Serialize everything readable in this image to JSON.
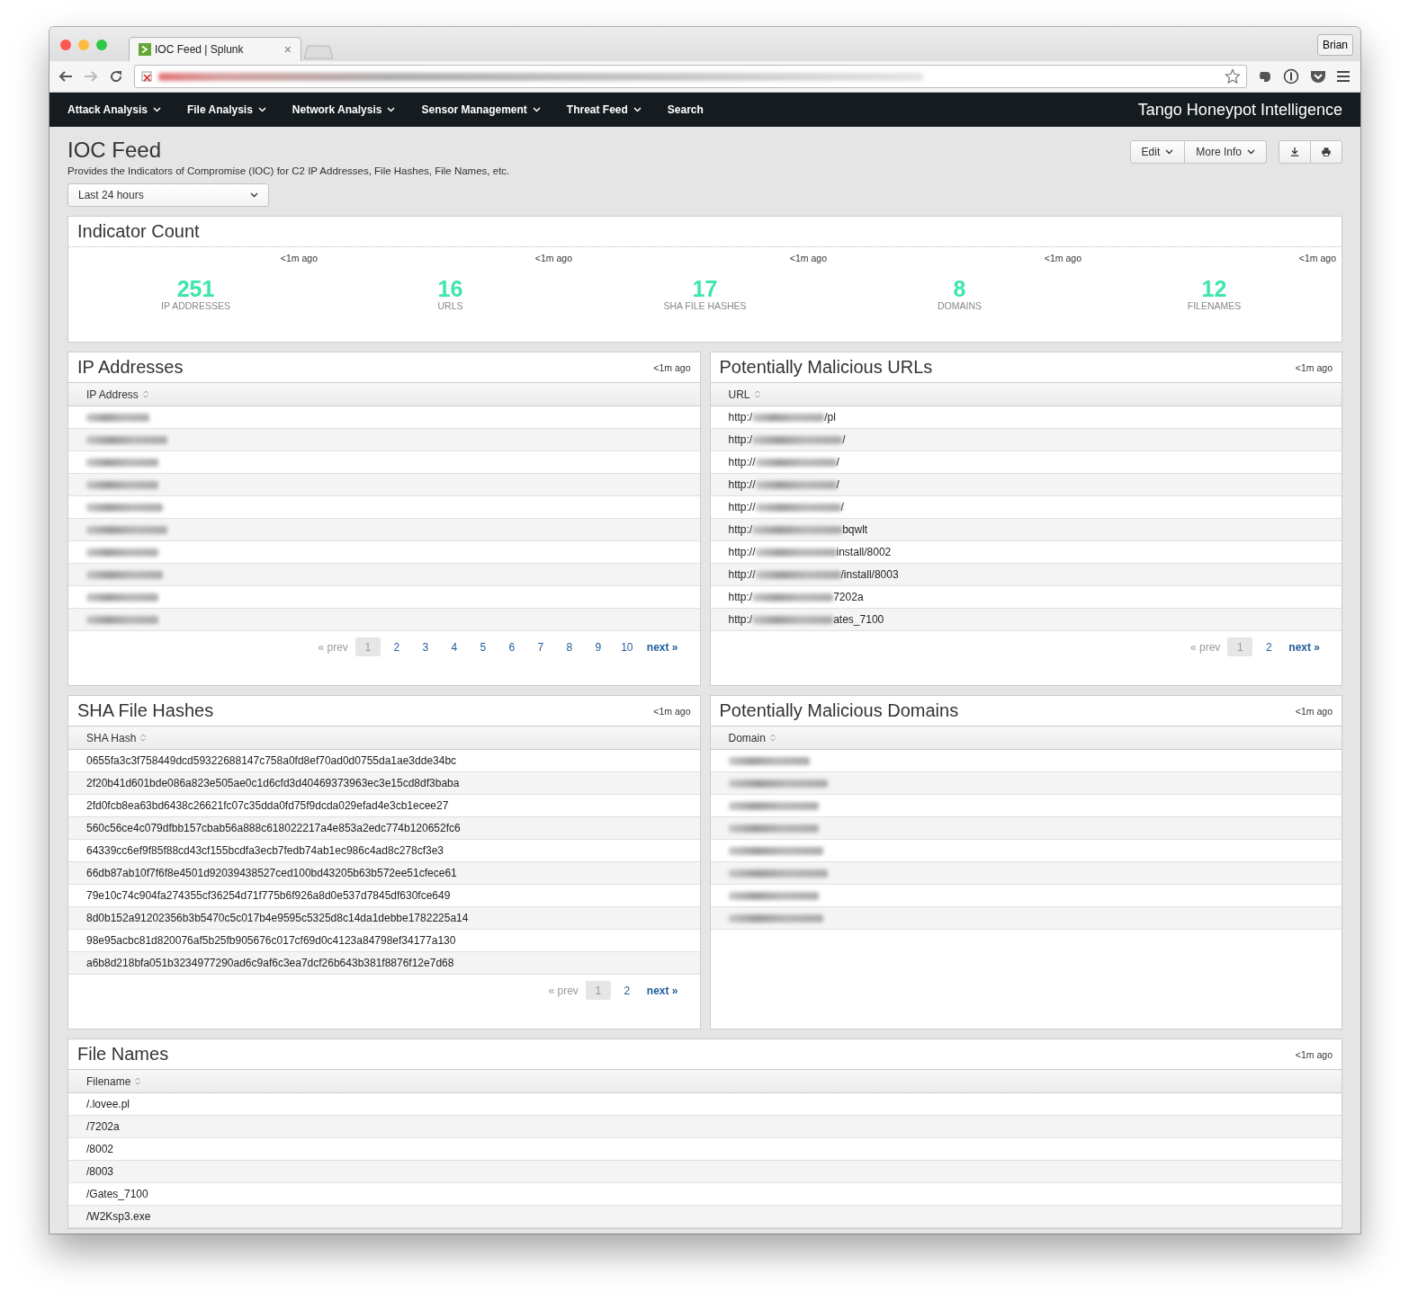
{
  "browser": {
    "tab_title": "IOC Feed | Splunk",
    "tab_close": "×",
    "user": "Brian",
    "address": {
      "kind": "redacted"
    }
  },
  "nav": {
    "items": [
      {
        "label": "Attack Analysis",
        "has_menu": true
      },
      {
        "label": "File Analysis",
        "has_menu": true
      },
      {
        "label": "Network Analysis",
        "has_menu": true
      },
      {
        "label": "Sensor Management",
        "has_menu": true
      },
      {
        "label": "Threat Feed",
        "has_menu": true
      },
      {
        "label": "Search",
        "has_menu": false
      }
    ],
    "brand": "Tango Honeypot Intelligence"
  },
  "dashboard": {
    "title": "IOC Feed",
    "description": "Provides the Indicators of Compromise (IOC) for C2 IP Addresses, File Hashes, File Names, etc.",
    "time_picker": "Last 24 hours",
    "buttons": [
      "Edit",
      "More Info"
    ]
  },
  "indicator_count": {
    "title": "Indicator Count",
    "singles": [
      {
        "age": "<1m ago",
        "value": "251",
        "label": "IP ADDRESSES"
      },
      {
        "age": "<1m ago",
        "value": "16",
        "label": "URLS"
      },
      {
        "age": "<1m ago",
        "value": "17",
        "label": "SHA FILE HASHES"
      },
      {
        "age": "<1m ago",
        "value": "8",
        "label": "DOMAINS"
      },
      {
        "age": "<1m ago",
        "value": "12",
        "label": "FILENAMES"
      }
    ]
  },
  "panels": [
    {
      "title": "IP Addresses",
      "age": "<1m ago",
      "column": "IP Address",
      "rows": [
        {
          "kind": "redacted"
        },
        {
          "kind": "redacted"
        },
        {
          "kind": "redacted"
        },
        {
          "kind": "redacted"
        },
        {
          "kind": "redacted"
        },
        {
          "kind": "redacted"
        },
        {
          "kind": "redacted"
        },
        {
          "kind": "redacted"
        },
        {
          "kind": "redacted"
        },
        {
          "kind": "redacted"
        }
      ],
      "pagination": {
        "prev": "« prev",
        "prev_disabled": true,
        "pages": [
          {
            "label": "1",
            "selected": true
          },
          {
            "label": "2",
            "selected": false
          },
          {
            "label": "3",
            "selected": false
          },
          {
            "label": "4",
            "selected": false
          },
          {
            "label": "5",
            "selected": false
          },
          {
            "label": "6",
            "selected": false
          },
          {
            "label": "7",
            "selected": false
          },
          {
            "label": "8",
            "selected": false
          },
          {
            "label": "9",
            "selected": false
          },
          {
            "label": "10",
            "selected": false
          }
        ],
        "next": "next »"
      }
    },
    {
      "title": "Potentially Malicious URLs",
      "age": "<1m ago",
      "column": "URL",
      "rows": [
        {
          "kind": "partial",
          "prefix": "http:/",
          "suffix": "/pl"
        },
        {
          "kind": "partial",
          "prefix": "http:/",
          "suffix": "/"
        },
        {
          "kind": "partial",
          "prefix": "http://",
          "suffix": "/"
        },
        {
          "kind": "partial",
          "prefix": "http://",
          "suffix": "/"
        },
        {
          "kind": "partial",
          "prefix": "http://",
          "suffix": "/"
        },
        {
          "kind": "partial",
          "prefix": "http:/",
          "suffix": "bqwlt"
        },
        {
          "kind": "partial",
          "prefix": "http://",
          "suffix": "install/8002"
        },
        {
          "kind": "partial",
          "prefix": "http://",
          "suffix": "/install/8003"
        },
        {
          "kind": "partial",
          "prefix": "http:/",
          "suffix": "7202a"
        },
        {
          "kind": "partial",
          "prefix": "http:/",
          "suffix": "ates_7100"
        }
      ],
      "pagination": {
        "prev": "« prev",
        "prev_disabled": true,
        "pages": [
          {
            "label": "1",
            "selected": true
          },
          {
            "label": "2",
            "selected": false
          }
        ],
        "next": "next »"
      }
    },
    {
      "title": "SHA File Hashes",
      "age": "<1m ago",
      "column": "SHA Hash",
      "rows": [
        {
          "kind": "text",
          "value": "0655fa3c3f758449dcd59322688147c758a0fd8ef70ad0d0755da1ae3dde34bc"
        },
        {
          "kind": "text",
          "value": "2f20b41d601bde086a823e505ae0c1d6cfd3d40469373963ec3e15cd8df3baba"
        },
        {
          "kind": "text",
          "value": "2fd0fcb8ea63bd6438c26621fc07c35dda0fd75f9dcda029efad4e3cb1ecee27"
        },
        {
          "kind": "text",
          "value": "560c56ce4c079dfbb157cbab56a888c618022217a4e853a2edc774b120652fc6"
        },
        {
          "kind": "text",
          "value": "64339cc6ef9f85f88cd43cf155bcdfa3ecb7fedb74ab1ec986c4ad8c278cf3e3"
        },
        {
          "kind": "text",
          "value": "66db87ab10f7f6f8e4501d92039438527ced100bd43205b63b572ee51cfece61"
        },
        {
          "kind": "text",
          "value": "79e10c74c904fa274355cf36254d71f775b6f926a8d0e537d7845df630fce649"
        },
        {
          "kind": "text",
          "value": "8d0b152a91202356b3b5470c5c017b4e9595c5325d8c14da1debbe1782225a14"
        },
        {
          "kind": "text",
          "value": "98e95acbc81d820076af5b25fb905676c017cf69d0c4123a84798ef34177a130"
        },
        {
          "kind": "text",
          "value": "a6b8d218bfa051b3234977290ad6c9af6c3ea7dcf26b643b381f8876f12e7d68"
        }
      ],
      "pagination": {
        "prev": "« prev",
        "prev_disabled": true,
        "pages": [
          {
            "label": "1",
            "selected": true
          },
          {
            "label": "2",
            "selected": false
          }
        ],
        "next": "next »"
      }
    },
    {
      "title": "Potentially Malicious Domains",
      "age": "<1m ago",
      "column": "Domain",
      "rows": [
        {
          "kind": "redacted"
        },
        {
          "kind": "redacted"
        },
        {
          "kind": "redacted"
        },
        {
          "kind": "redacted"
        },
        {
          "kind": "redacted"
        },
        {
          "kind": "redacted"
        },
        {
          "kind": "redacted"
        },
        {
          "kind": "redacted"
        }
      ]
    },
    {
      "title": "File Names",
      "age": "<1m ago",
      "column": "Filename",
      "wide": true,
      "rows": [
        {
          "kind": "text",
          "value": "/.lovee.pl"
        },
        {
          "kind": "text",
          "value": "/7202a"
        },
        {
          "kind": "text",
          "value": "/8002"
        },
        {
          "kind": "text",
          "value": "/8003"
        },
        {
          "kind": "text",
          "value": "/Gates_7100"
        },
        {
          "kind": "text",
          "value": "/W2Ksp3.exe"
        }
      ]
    }
  ]
}
